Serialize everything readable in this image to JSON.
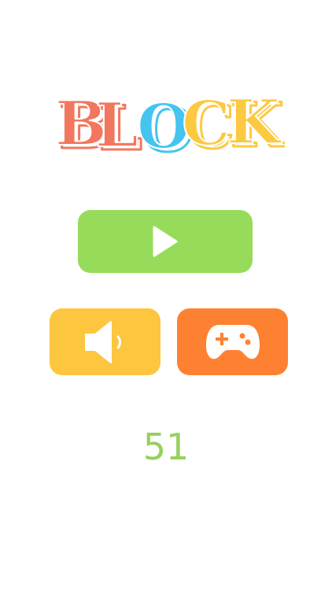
{
  "title": {
    "letters": [
      {
        "char": "B",
        "color": "#f2775f"
      },
      {
        "char": "L",
        "color": "#f2775f"
      },
      {
        "char": "O",
        "color": "#45c4f0"
      },
      {
        "char": "C",
        "color": "#fcc940"
      },
      {
        "char": "K",
        "color": "#fcc940"
      }
    ]
  },
  "buttons": {
    "play": {
      "icon": "play-icon",
      "color": "#96dc5a"
    },
    "sound": {
      "icon": "speaker-icon",
      "color": "#fdc63f"
    },
    "games": {
      "icon": "gamepad-icon",
      "color": "#fe8132"
    }
  },
  "score": {
    "value": "51",
    "color": "#96d05e"
  }
}
